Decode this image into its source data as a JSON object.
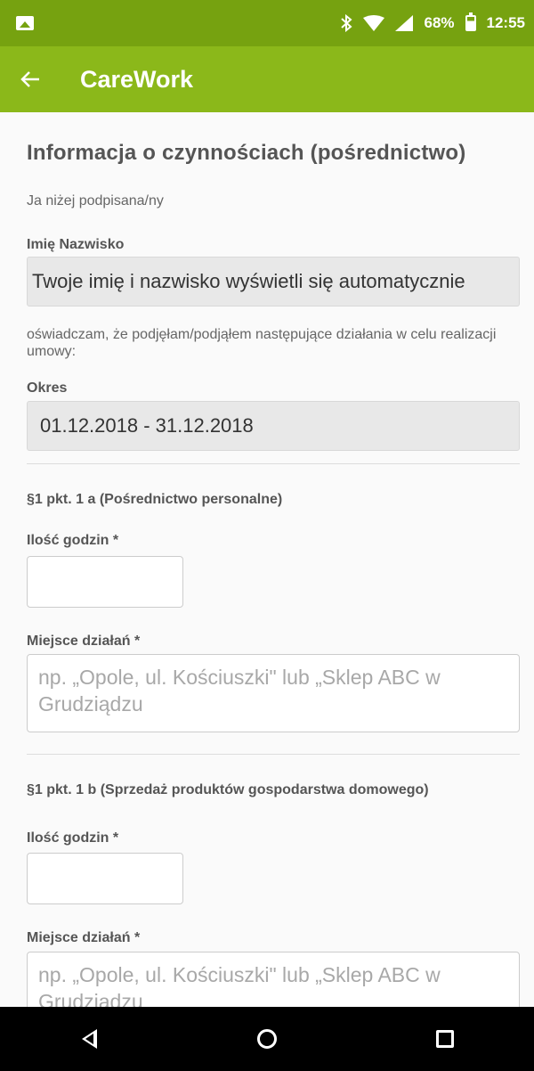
{
  "status_bar": {
    "battery": "68%",
    "time": "12:55",
    "icons": [
      "image-icon",
      "bluetooth-icon",
      "wifi-icon",
      "signal-icon",
      "battery-icon"
    ]
  },
  "app_bar": {
    "title": "CareWork",
    "back_icon": "arrow-left-icon"
  },
  "form": {
    "title": "Informacja o czynnościach (pośrednictwo)",
    "intro": "Ja niżej podpisana/ny",
    "name_label": "Imię Nazwisko",
    "name_value": "Twoje imię i nazwisko wyświetli się automatycznie",
    "statement": "oświadczam, że podjęłam/podjąłem następujące działania w celu realizacji umowy:",
    "period_label": "Okres",
    "period_value": "01.12.2018 - 31.12.2018",
    "sections": [
      {
        "title": "§1 pkt. 1 a (Pośrednictwo personalne)",
        "hours_label": "Ilość godzin *",
        "hours_value": "",
        "place_label": "Miejsce działań *",
        "place_placeholder": "np. „Opole, ul. Kościuszki\" lub „Sklep ABC w Grudziądzu"
      },
      {
        "title": "§1 pkt. 1 b (Sprzedaż produktów gospodarstwa domowego)",
        "hours_label": "Ilość godzin *",
        "hours_value": "",
        "place_label": "Miejsce działań *",
        "place_placeholder": "np. „Opole, ul. Kościuszki\" lub „Sklep ABC w Grudziądzu"
      }
    ]
  },
  "colors": {
    "status_bar": "#76a210",
    "app_bar": "#8bb81a"
  },
  "nav_bar": {
    "icons": [
      "nav-back-icon",
      "nav-home-icon",
      "nav-recents-icon"
    ]
  }
}
